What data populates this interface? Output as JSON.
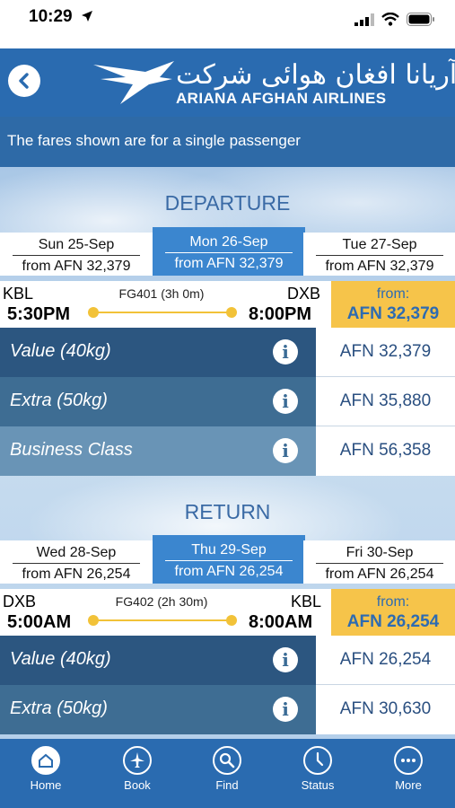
{
  "status": {
    "time": "10:29"
  },
  "header": {
    "logo_script": "دآریانا افغان هوائی شرکت",
    "logo_name": "ARIANA AFGHAN AIRLINES"
  },
  "notice": "The fares shown are for a single passenger",
  "departure": {
    "title": "DEPARTURE",
    "dates": [
      {
        "day": "Sun 25-Sep",
        "price": "from AFN 32,379",
        "selected": false
      },
      {
        "day": "Mon 26-Sep",
        "price": "from AFN 32,379",
        "selected": true
      },
      {
        "day": "Tue 27-Sep",
        "price": "from AFN 32,379",
        "selected": false
      }
    ],
    "flight": {
      "from_code": "KBL",
      "to_code": "DXB",
      "flight_no": "FG401 (3h 0m)",
      "dep_time": "5:30PM",
      "arr_time": "8:00PM",
      "from_label": "from:",
      "from_price": "AFN 32,379"
    },
    "fares": [
      {
        "name": "Value (40kg)",
        "price": "AFN 32,379",
        "color": "#2c5680"
      },
      {
        "name": "Extra (50kg)",
        "price": "AFN 35,880",
        "color": "#3e6d93"
      },
      {
        "name": "Business Class",
        "price": "AFN 56,358",
        "color": "#6994b6"
      }
    ]
  },
  "return": {
    "title": "RETURN",
    "dates": [
      {
        "day": "Wed 28-Sep",
        "price": "from AFN 26,254",
        "selected": false
      },
      {
        "day": "Thu 29-Sep",
        "price": "from AFN 26,254",
        "selected": true
      },
      {
        "day": "Fri 30-Sep",
        "price": "from AFN 26,254",
        "selected": false
      }
    ],
    "flight": {
      "from_code": "DXB",
      "to_code": "KBL",
      "flight_no": "FG402 (2h 30m)",
      "dep_time": "5:00AM",
      "arr_time": "8:00AM",
      "from_label": "from:",
      "from_price": "AFN 26,254"
    },
    "fares": [
      {
        "name": "Value (40kg)",
        "price": "AFN 26,254",
        "color": "#2c5680"
      },
      {
        "name": "Extra (50kg)",
        "price": "AFN 30,630",
        "color": "#3e6d93"
      }
    ]
  },
  "tabs": [
    {
      "label": "Home",
      "icon": "home-icon"
    },
    {
      "label": "Book",
      "icon": "airplane-icon"
    },
    {
      "label": "Find",
      "icon": "search-icon"
    },
    {
      "label": "Status",
      "icon": "clock-icon"
    },
    {
      "label": "More",
      "icon": "more-icon"
    }
  ],
  "colors": {
    "brand": "#2a6bb0",
    "highlight": "#f6c44a",
    "selected_date": "#3b86cf"
  }
}
